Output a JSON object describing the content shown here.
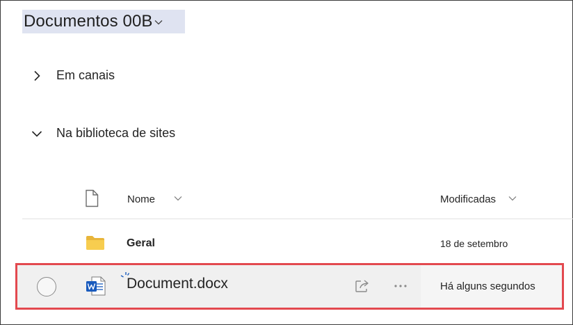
{
  "header": {
    "title": "Documentos 00B"
  },
  "sections": [
    {
      "label": "Em canais",
      "expanded": false,
      "icon": "chevron-right-icon"
    },
    {
      "label": "Na biblioteca de sites",
      "expanded": true,
      "icon": "chevron-down-icon"
    }
  ],
  "table": {
    "columns": {
      "name": "Nome",
      "modified": "Modificadas"
    },
    "rows": [
      {
        "name": "Geral",
        "modified": "18 de setembro",
        "type": "folder",
        "icon": "folder-icon"
      },
      {
        "name": "Document.docx",
        "modified": "Há alguns segundos",
        "type": "word",
        "icon": "word-doc-icon",
        "new": true
      }
    ]
  },
  "colors": {
    "title_highlight": "#dfe3f1",
    "selection_border": "#e3494f",
    "folder": "#f2c94c",
    "word": "#185abd"
  }
}
